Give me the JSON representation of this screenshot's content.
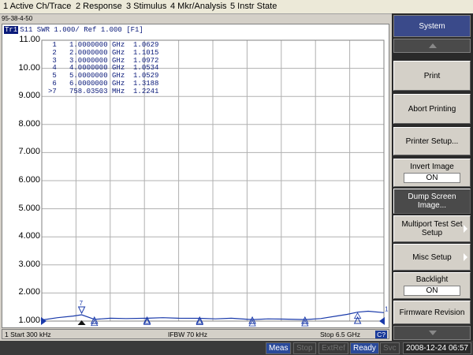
{
  "menu": [
    {
      "label": "1 Active Ch/Trace"
    },
    {
      "label": "2 Response"
    },
    {
      "label": "3 Stimulus"
    },
    {
      "label": "4 Mkr/Analysis"
    },
    {
      "label": "5 Instr State"
    }
  ],
  "window_title": "95-38-4-50",
  "trace": {
    "tag": "Tr1",
    "label": "S11  SWR 1.000/ Ref 1.000 [F1]"
  },
  "y_ticks": [
    "11.00",
    "10.00",
    "9.000",
    "8.000",
    "7.000",
    "6.000",
    "5.000",
    "4.000",
    "3.000",
    "2.000",
    "1.000"
  ],
  "markers": [
    {
      "text": " 1   1.0000000 GHz  1.0629"
    },
    {
      "text": " 2   2.0000000 GHz  1.1015"
    },
    {
      "text": " 3   3.0000000 GHz  1.0972"
    },
    {
      "text": " 4   4.0000000 GHz  1.0534"
    },
    {
      "text": " 5   5.0000000 GHz  1.0529"
    },
    {
      "text": " 6   6.0000000 GHz  1.3188"
    },
    {
      "text": ">7   758.03503 MHz  1.2241"
    }
  ],
  "status": {
    "start": "1  Start 300 kHz",
    "ifbw": "IFBW 70 kHz",
    "stop": "Stop 6.5 GHz",
    "channel_badge": "C?"
  },
  "softkeys": {
    "title": "System",
    "items": [
      {
        "label": "Print",
        "value": null,
        "dark": false,
        "arrow": false
      },
      {
        "label": "Abort Printing",
        "value": null,
        "dark": false,
        "arrow": false
      },
      {
        "label": "Printer Setup...",
        "value": null,
        "dark": false,
        "arrow": false
      },
      {
        "label": "Invert Image",
        "value": "ON",
        "dark": false,
        "arrow": false
      },
      {
        "label": "Dump Screen Image...",
        "value": null,
        "dark": true,
        "arrow": false
      },
      {
        "label": "Multiport Test Set Setup",
        "value": null,
        "dark": false,
        "arrow": true
      },
      {
        "label": "Misc Setup",
        "value": null,
        "dark": false,
        "arrow": true
      },
      {
        "label": "Backlight",
        "value": "ON",
        "dark": false,
        "arrow": false
      },
      {
        "label": "Firmware Revision",
        "value": null,
        "dark": false,
        "arrow": false
      }
    ]
  },
  "bottom_status": {
    "meas": "Meas",
    "stop": "Stop",
    "extref": "ExtRef",
    "ready": "Ready",
    "svc": "Svc",
    "datetime": "2008-12-24 06:57"
  },
  "chart_data": {
    "type": "line",
    "title": "",
    "xlabel": "",
    "ylabel": "",
    "x_range_ghz": [
      0.0003,
      6.5
    ],
    "ylim": [
      1.0,
      11.0
    ],
    "y_ticks": [
      1,
      2,
      3,
      4,
      5,
      6,
      7,
      8,
      9,
      10,
      11
    ],
    "x_divisions": 10,
    "grid": true,
    "trace_color": "#1a3aaa",
    "series": [
      {
        "name": "S11",
        "x": [
          0.0003,
          0.3,
          0.6,
          0.758,
          1.0,
          1.3,
          1.6,
          2.0,
          2.3,
          2.6,
          3.0,
          3.3,
          3.6,
          4.0,
          4.3,
          4.6,
          5.0,
          5.3,
          5.6,
          5.8,
          6.0,
          6.2,
          6.5
        ],
        "y": [
          1.04,
          1.12,
          1.18,
          1.2241,
          1.0629,
          1.1,
          1.09,
          1.1015,
          1.12,
          1.1,
          1.0972,
          1.08,
          1.1,
          1.0534,
          1.08,
          1.07,
          1.0529,
          1.09,
          1.18,
          1.24,
          1.3188,
          1.35,
          1.3
        ]
      }
    ],
    "markers": [
      {
        "id": "1",
        "x": 1.0,
        "y": 1.0629
      },
      {
        "id": "2",
        "x": 2.0,
        "y": 1.1015
      },
      {
        "id": "3",
        "x": 3.0,
        "y": 1.0972
      },
      {
        "id": "4",
        "x": 4.0,
        "y": 1.0534
      },
      {
        "id": "5",
        "x": 5.0,
        "y": 1.0529
      },
      {
        "id": "6",
        "x": 6.0,
        "y": 1.3188
      },
      {
        "id": "7",
        "x": 0.758,
        "y": 1.2241
      }
    ]
  }
}
